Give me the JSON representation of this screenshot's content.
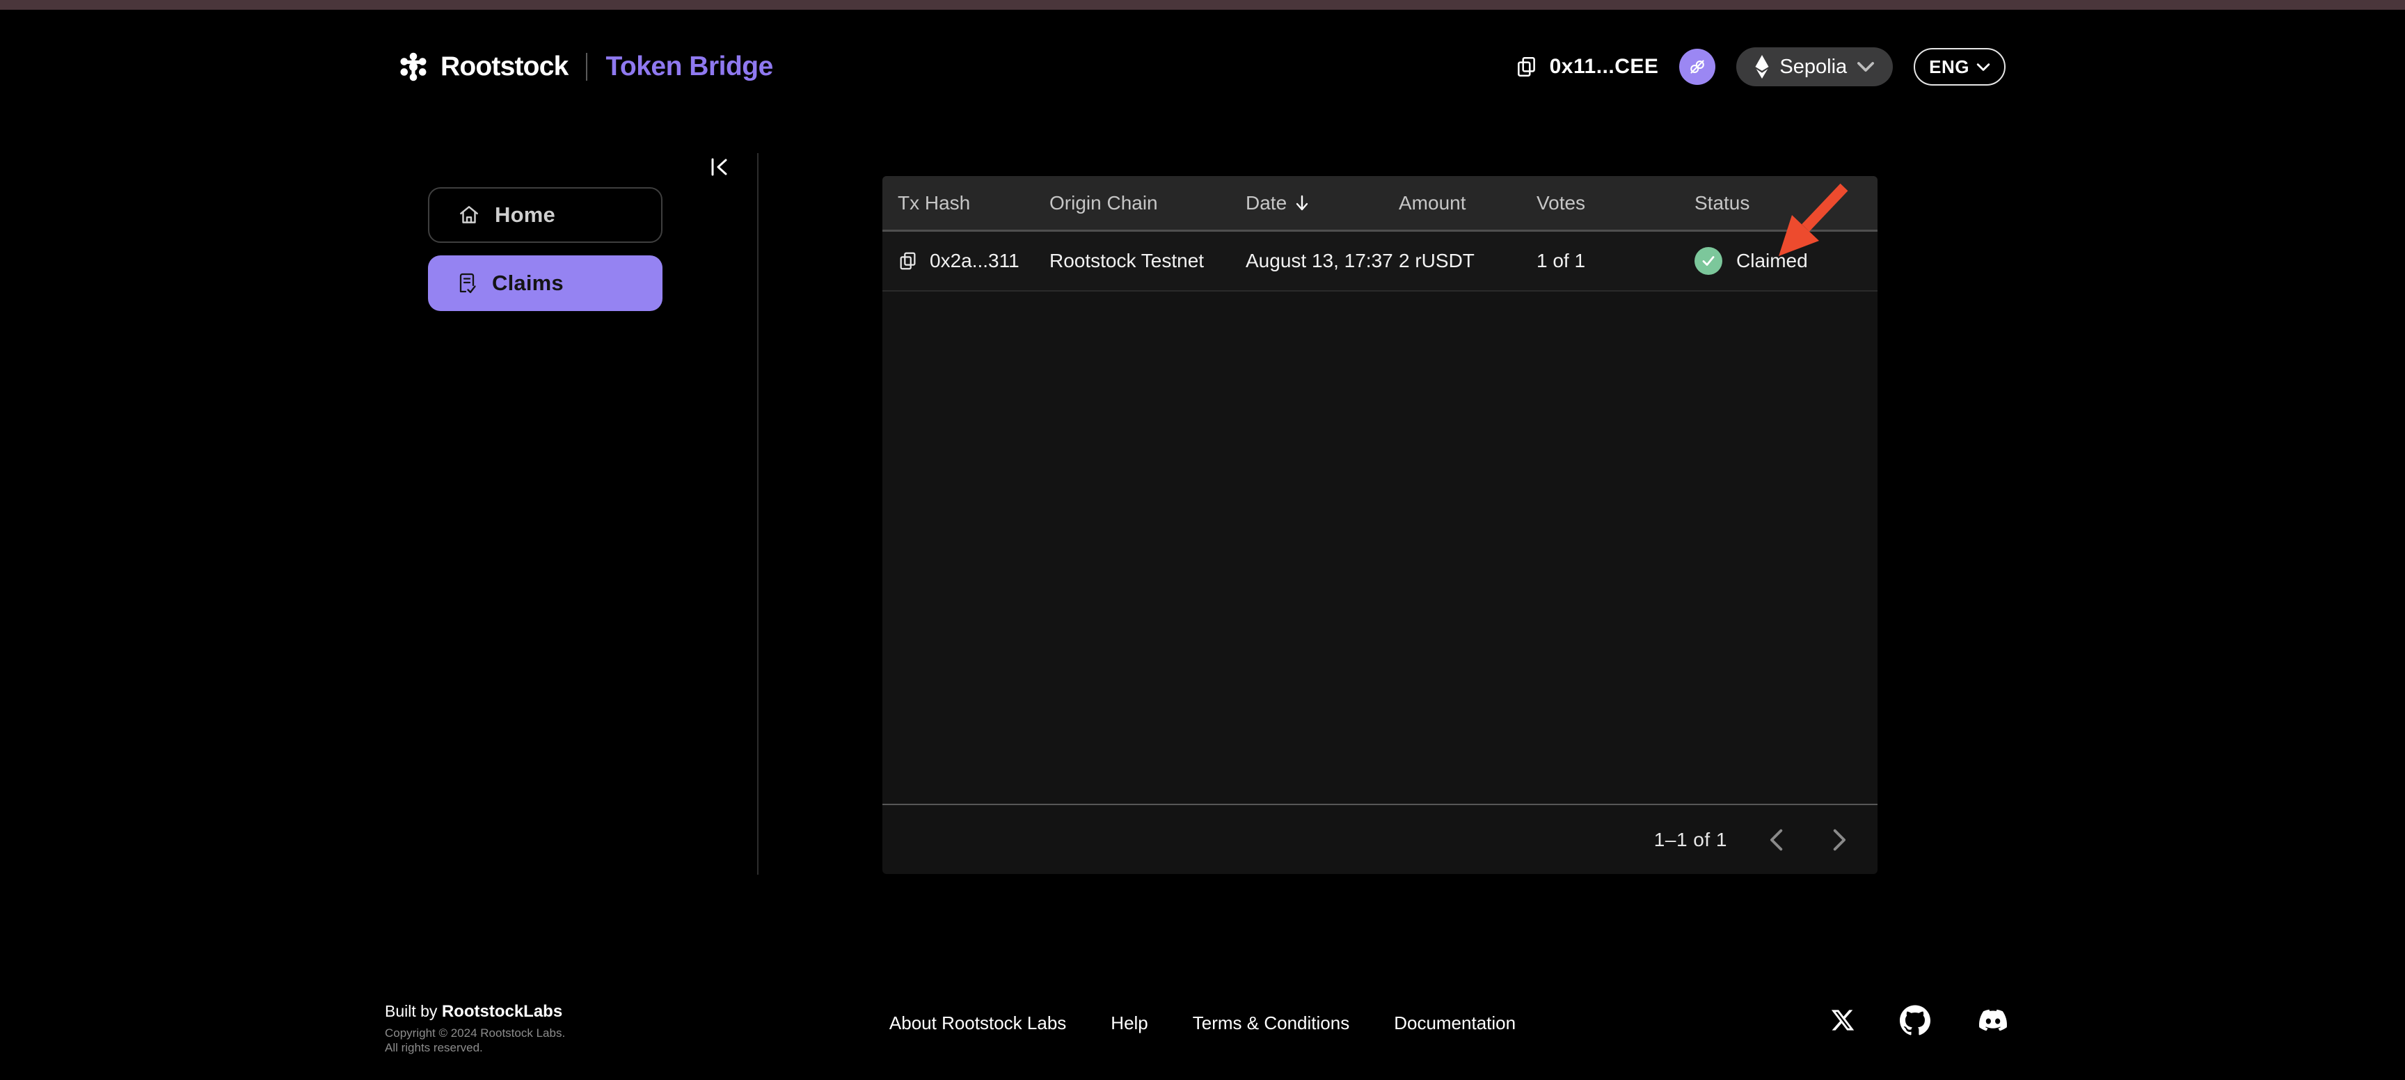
{
  "brand": {
    "name": "Rootstock",
    "product": "Token Bridge"
  },
  "header": {
    "wallet_address": "0x11...CEE",
    "network_label": "Sepolia",
    "language_label": "ENG"
  },
  "sidebar": {
    "items": [
      {
        "label": "Home",
        "icon": "home-icon",
        "active": false
      },
      {
        "label": "Claims",
        "icon": "claims-icon",
        "active": true
      }
    ]
  },
  "claims_table": {
    "columns": [
      "Tx Hash",
      "Origin Chain",
      "Date",
      "Amount",
      "Votes",
      "Status"
    ],
    "sorted_column": "Date",
    "sort_direction": "descending",
    "rows": [
      {
        "tx_hash": "0x2a...311",
        "origin_chain": "Rootstock Testnet",
        "date": "August 13, 17:37",
        "amount": "2 rUSDT",
        "votes": "1 of 1",
        "status": "Claimed"
      }
    ],
    "pagination_label": "1–1 of 1"
  },
  "footer": {
    "built_by_prefix": "Built by ",
    "built_by_name": "RootstockLabs",
    "copyright_line1": "Copyright © 2024 Rootstock Labs.",
    "copyright_line2": "All rights reserved.",
    "links": [
      "About Rootstock Labs",
      "Help",
      "Terms & Conditions",
      "Documentation"
    ],
    "social_icons": [
      "x-twitter-icon",
      "github-icon",
      "discord-icon"
    ]
  },
  "colors": {
    "accent_purple": "#9583f2",
    "brand_purple": "#8f79f0",
    "success_green": "#7cc79b",
    "annotation_red": "#ed4b2e",
    "top_strip": "#4a363b",
    "panel_bg": "#131313",
    "table_header_bg": "#272727"
  }
}
